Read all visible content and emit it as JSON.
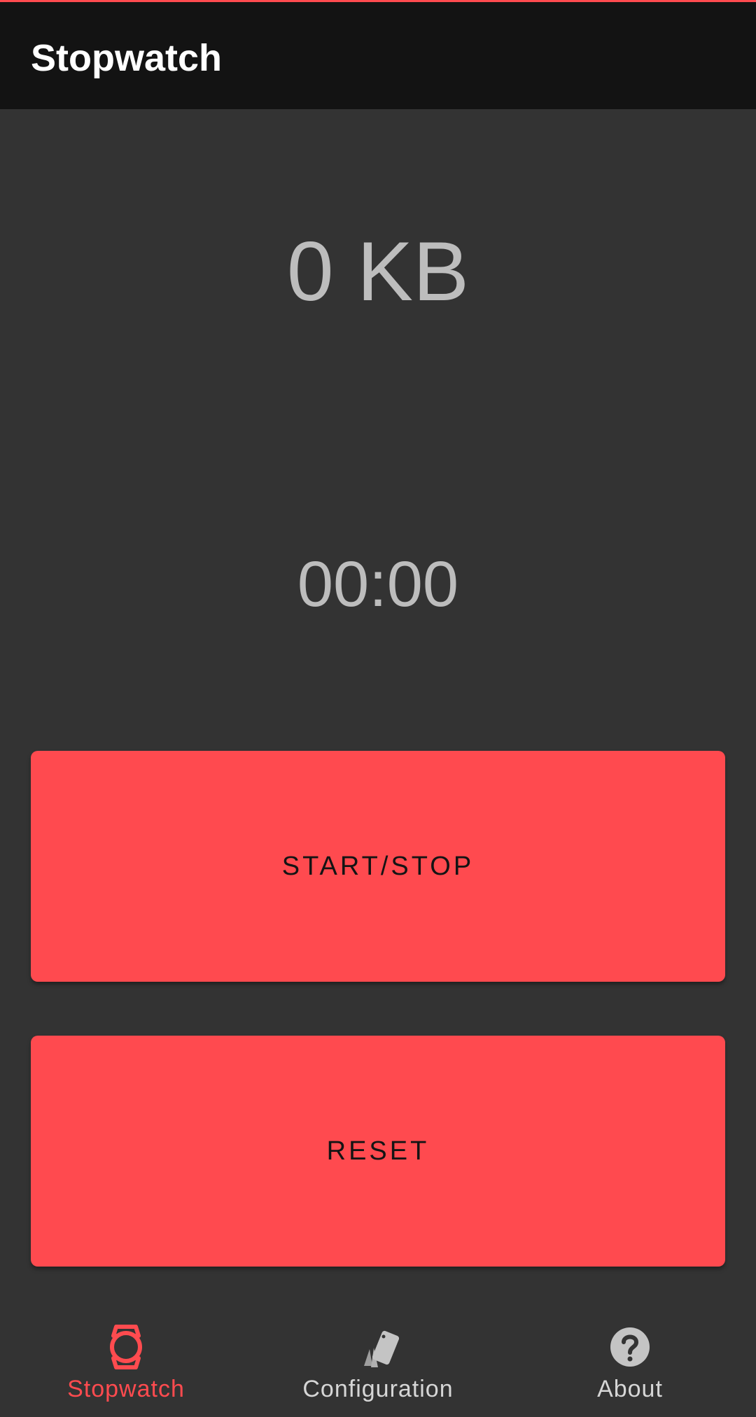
{
  "app_bar": {
    "title": "Stopwatch"
  },
  "main": {
    "data_size": "0 KB",
    "elapsed_time": "00:00",
    "start_stop_label": "START/STOP",
    "reset_label": "RESET"
  },
  "bottom_nav": {
    "items": [
      {
        "label": "Stopwatch",
        "icon": "watch-icon",
        "active": true
      },
      {
        "label": "Configuration",
        "icon": "cards-icon",
        "active": false
      },
      {
        "label": "About",
        "icon": "help-circle-icon",
        "active": false
      }
    ]
  },
  "colors": {
    "accent": "#ff4b4f",
    "background": "#333333",
    "app_bar": "#131313",
    "text_secondary": "#bdbdbd"
  }
}
